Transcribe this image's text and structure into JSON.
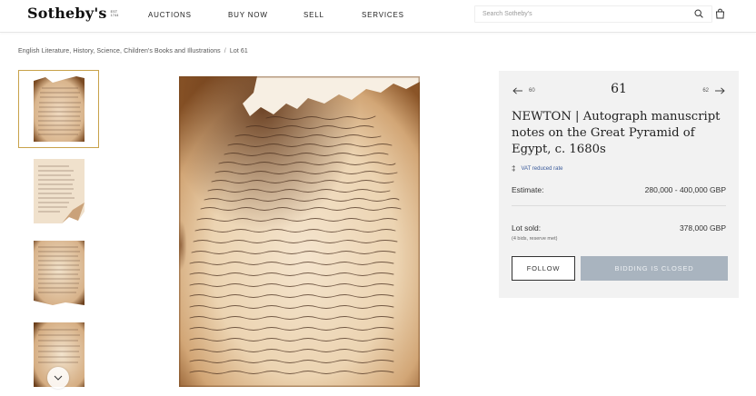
{
  "header": {
    "logo": "Sotheby's",
    "logo_sub": [
      "EST",
      "1744"
    ],
    "nav": [
      "AUCTIONS",
      "BUY NOW",
      "SELL",
      "SERVICES"
    ],
    "search_placeholder": "Search Sotheby's",
    "icons": {
      "search": "search-icon",
      "bag": "bag-icon"
    }
  },
  "breadcrumb": {
    "category": "English Literature, History, Science, Children's Books and Illustrations",
    "separator": "/",
    "current": "Lot 61"
  },
  "thumbnails": {
    "count": 4,
    "active_index": 0,
    "scroll_icon": "chevron-down-icon"
  },
  "lot": {
    "prev_number": "60",
    "number": "61",
    "next_number": "62",
    "title": "NEWTON | Autograph manuscript notes on the Great Pyramid of Egypt, c. 1680s",
    "vat_symbol": "‡",
    "vat_text": "VAT reduced rate",
    "estimate_label": "Estimate:",
    "estimate_value": "280,000 - 400,000 GBP",
    "sold_label": "Lot sold:",
    "sold_value": "378,000 GBP",
    "sold_note": "(4 bids, reserve met)",
    "follow_label": "FOLLOW",
    "bidding_label": "BIDDING IS CLOSED"
  },
  "colors": {
    "panel_bg": "#f2f2f2",
    "active_thumb_border": "#c8a24a",
    "bid_button_disabled": "#a9b4bf",
    "vat_link": "#3a5a9a"
  }
}
